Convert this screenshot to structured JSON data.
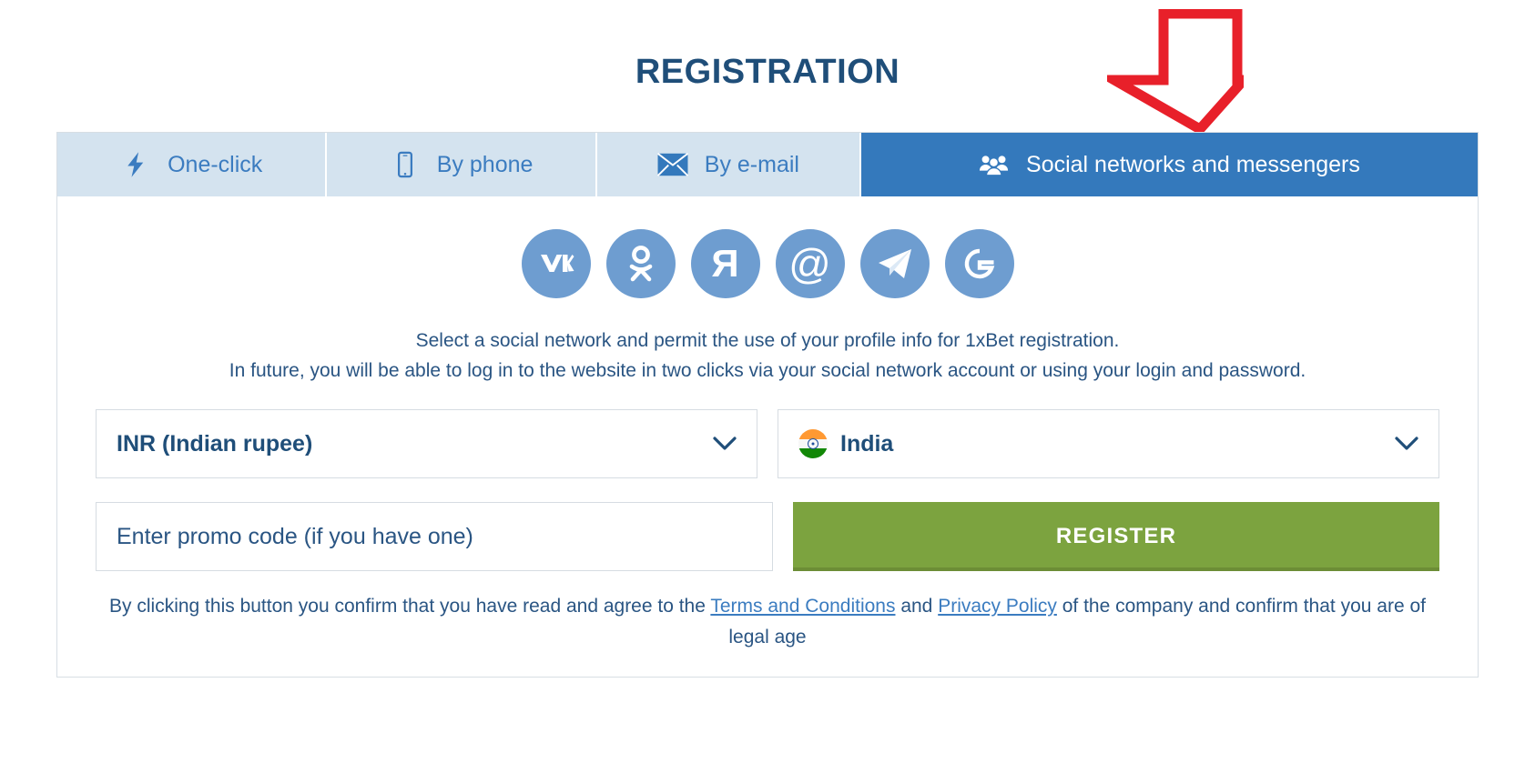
{
  "page": {
    "title": "REGISTRATION"
  },
  "annotation": {
    "arrow": "down-arrow-annotation",
    "color": "#e8202a"
  },
  "tabs": [
    {
      "id": "one-click",
      "label": "One-click",
      "icon": "lightning-bolt-icon",
      "active": false
    },
    {
      "id": "by-phone",
      "label": "By phone",
      "icon": "mobile-phone-icon",
      "active": false
    },
    {
      "id": "by-email",
      "label": "By e-mail",
      "icon": "envelope-icon",
      "active": false
    },
    {
      "id": "social-networks",
      "label": "Social networks and messengers",
      "icon": "people-group-icon",
      "active": true
    }
  ],
  "social_networks": [
    {
      "id": "vk",
      "name": "vk-icon",
      "glyph": "VK"
    },
    {
      "id": "odnoklassniki",
      "name": "odnoklassniki-icon",
      "glyph": ""
    },
    {
      "id": "yandex",
      "name": "yandex-icon",
      "glyph": "Я"
    },
    {
      "id": "mailru",
      "name": "mailru-icon",
      "glyph": "@"
    },
    {
      "id": "telegram",
      "name": "telegram-icon",
      "glyph": ""
    },
    {
      "id": "google",
      "name": "google-icon",
      "glyph": "G"
    }
  ],
  "description": {
    "line1": "Select a social network and permit the use of your profile info for 1xBet registration.",
    "line2": "In future, you will be able to log in to the website in two clicks via your social network account or using your login and password."
  },
  "form": {
    "currency": {
      "label": "currency-select",
      "value": "INR (Indian rupee)"
    },
    "country": {
      "label": "country-select",
      "value": "India",
      "flag": "india-flag-icon"
    },
    "promo": {
      "placeholder": "Enter promo code (if you have one)",
      "value": ""
    },
    "register_label": "REGISTER"
  },
  "terms": {
    "prefix": "By clicking this button you confirm that you have read and agree to the ",
    "link1": "Terms and Conditions",
    "middle": " and ",
    "link2": "Privacy Policy",
    "suffix": " of the company and confirm that you are of legal age"
  },
  "colors": {
    "title": "#1f4e79",
    "tab_active_bg": "#3479bc",
    "tab_bg": "#d4e3ef",
    "social_circle": "#6e9dd0",
    "register_bg": "#7ca33f",
    "arrow": "#e8202a",
    "link": "#3b7cc0"
  }
}
